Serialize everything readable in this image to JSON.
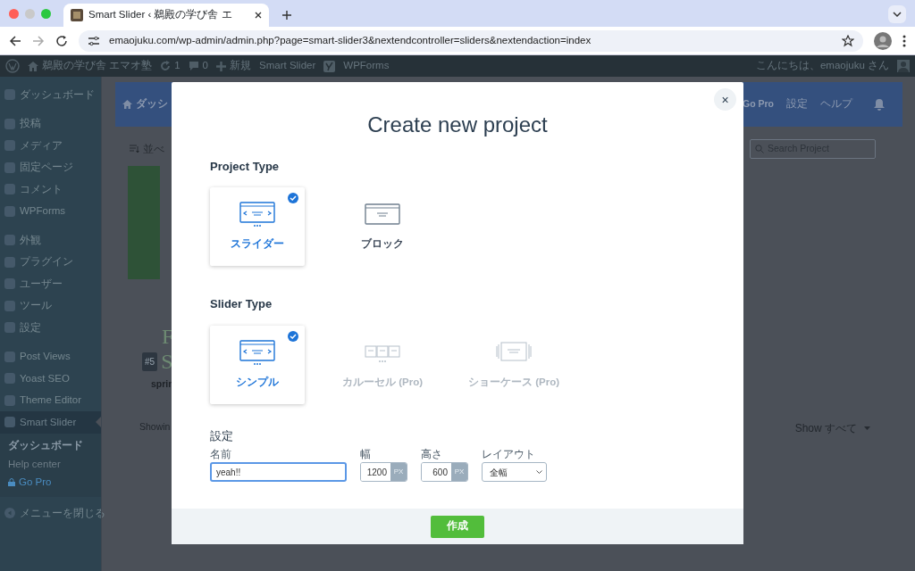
{
  "browser": {
    "tab_title": "Smart Slider ‹ 鵜殿の学び舎 エ",
    "url": "emaojuku.com/wp-admin/admin.php?page=smart-slider3&nextendcontroller=sliders&nextendaction=index"
  },
  "admin_bar": {
    "site": "鵜殿の学び舎 エマオ塾",
    "updates": "1",
    "comments": "0",
    "new": "新規",
    "items": [
      "Smart Slider",
      "WPForms"
    ],
    "greeting": "こんにちは、emaojuku さん"
  },
  "sidebar": {
    "sections": [
      [
        {
          "label": "ダッシュボード",
          "selected": false
        }
      ],
      [
        {
          "label": "投稿",
          "selected": false
        },
        {
          "label": "メディア",
          "selected": false
        },
        {
          "label": "固定ページ",
          "selected": false
        },
        {
          "label": "コメント",
          "selected": false
        },
        {
          "label": "WPForms",
          "selected": false
        }
      ],
      [
        {
          "label": "外観",
          "selected": false
        },
        {
          "label": "プラグイン",
          "selected": false
        },
        {
          "label": "ユーザー",
          "selected": false
        },
        {
          "label": "ツール",
          "selected": false
        },
        {
          "label": "設定",
          "selected": false
        }
      ],
      [
        {
          "label": "Post Views",
          "selected": false
        },
        {
          "label": "Yoast SEO",
          "selected": false
        },
        {
          "label": "Theme Editor",
          "selected": false
        },
        {
          "label": "Smart Slider",
          "selected": true
        }
      ]
    ],
    "submenu": [
      {
        "label": "ダッシュボード",
        "selected": true,
        "kind": "link"
      },
      {
        "label": "Help center",
        "selected": false,
        "kind": "link"
      },
      {
        "label": "Go Pro",
        "selected": false,
        "kind": "pro"
      }
    ],
    "collapse": "メニューを閉じる"
  },
  "plugin": {
    "header_left": "ダッシ",
    "nav": [
      "Go Pro",
      "設定",
      "ヘルプ"
    ],
    "sort": "並べ",
    "search": {
      "placeholder": "Search Project"
    },
    "slide_letter": "F",
    "badge": "#5",
    "slide_title_letter": "S",
    "slide_name": "sprin",
    "showing": "Showin",
    "show": "Show すべて"
  },
  "modal": {
    "close_button": "×",
    "title": "Create new project",
    "project_type": {
      "heading": "Project Type",
      "options": [
        {
          "label": "スライダー",
          "kind": "slider",
          "selected": true
        },
        {
          "label": "ブロック",
          "kind": "block",
          "selected": false
        }
      ]
    },
    "slider_type": {
      "heading": "Slider Type",
      "options": [
        {
          "label": "シンプル",
          "kind": "simple",
          "selected": true,
          "disabled": false
        },
        {
          "label": "カルーセル (Pro)",
          "kind": "carousel",
          "selected": false,
          "disabled": true
        },
        {
          "label": "ショーケース (Pro)",
          "kind": "showcase",
          "selected": false,
          "disabled": true
        }
      ]
    },
    "settings": {
      "heading": "設定",
      "name": {
        "label": "名前",
        "value": "yeah!!"
      },
      "width": {
        "label": "幅",
        "value": "1200",
        "unit": "PX"
      },
      "height": {
        "label": "高さ",
        "value": "600",
        "unit": "PX"
      },
      "layout": {
        "label": "レイアウト",
        "value": "全幅"
      }
    },
    "create_button": "作成"
  }
}
